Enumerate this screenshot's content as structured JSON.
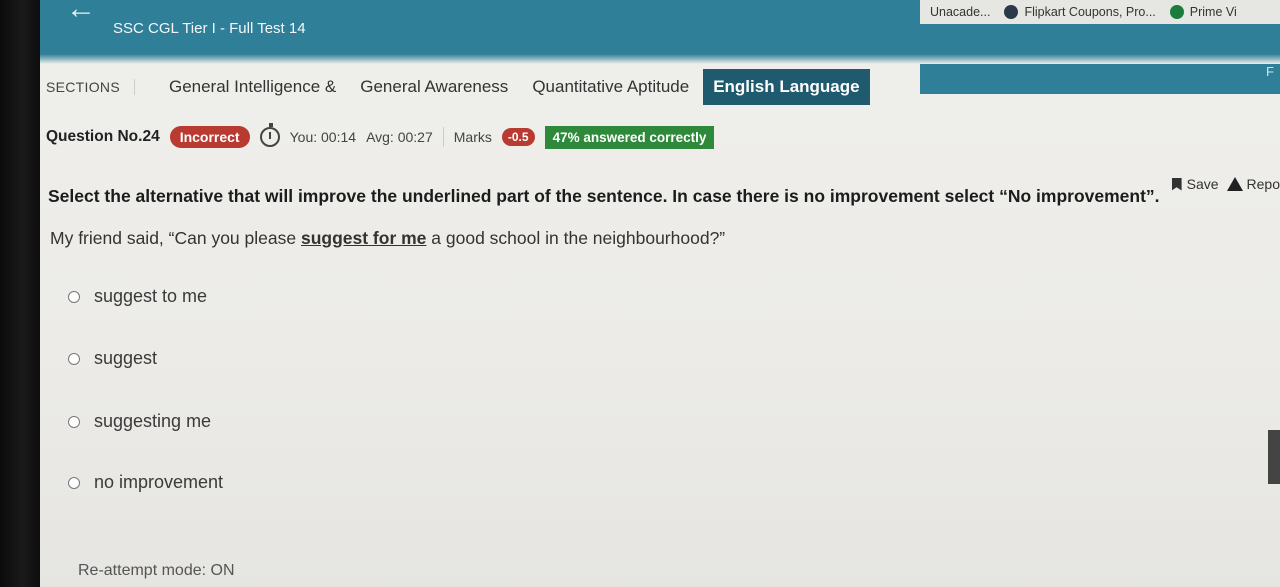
{
  "browser": {
    "bookmarks": [
      {
        "label": "Unacade...",
        "icon": "unacademy-icon"
      },
      {
        "label": "Flipkart Coupons, Pro...",
        "icon": "flipkart-icon"
      },
      {
        "label": "Prime Vi",
        "icon": "prime-video-icon"
      }
    ]
  },
  "header": {
    "back_icon": "arrow-left-icon",
    "title": "SSC CGL Tier I - Full Test 14",
    "edge_text": "F"
  },
  "sections": {
    "label": "SECTIONS",
    "items": [
      {
        "label": "General Intelligence &",
        "active": false
      },
      {
        "label": "General Awareness",
        "active": false
      },
      {
        "label": "Quantitative Aptitude",
        "active": false
      },
      {
        "label": "English Language",
        "active": true
      }
    ]
  },
  "question_meta": {
    "number": "Question No.24",
    "status": "Incorrect",
    "you_time": "You: 00:14",
    "avg_time": "Avg: 00:27",
    "marks_label": "Marks",
    "marks_value": "-0.5",
    "answered": "47% answered correctly"
  },
  "actions": {
    "save": "Save",
    "report": "Repo"
  },
  "question": {
    "instruction": "Select the alternative that will improve the underlined part of the sentence. In case there is no improvement select “No improvement”.",
    "sentence_before": "My friend said, “Can you please ",
    "sentence_underlined": "suggest for me",
    "sentence_after": " a good school in the neighbourhood?”"
  },
  "options": [
    {
      "label": "suggest to me"
    },
    {
      "label": "suggest"
    },
    {
      "label": "suggesting me"
    },
    {
      "label": "no improvement"
    }
  ],
  "footer": {
    "mode": "Re-attempt mode: ON"
  },
  "colors": {
    "header": "#2e7f97",
    "active_section": "#1f5a6e",
    "incorrect": "#b83a30",
    "correct": "#2e8a3a"
  }
}
